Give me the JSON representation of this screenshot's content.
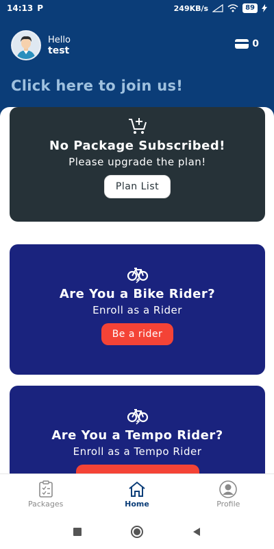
{
  "status_bar": {
    "time": "14:13",
    "carrier_icon": "P",
    "net_speed": "249KB/s",
    "battery": "89"
  },
  "header": {
    "hello": "Hello",
    "username": "test",
    "wallet_count": "0",
    "join_text": "Click here to join us!"
  },
  "cards": {
    "package": {
      "title": "No Package Subscribed!",
      "subtitle": "Please upgrade the plan!",
      "button": "Plan List"
    },
    "bike": {
      "title": "Are You a Bike Rider?",
      "subtitle": "Enroll as a Rider",
      "button": "Be a rider"
    },
    "tempo": {
      "title": "Are You a Tempo Rider?",
      "subtitle": "Enroll as a Tempo Rider",
      "button": ""
    }
  },
  "bottom_nav": {
    "items": [
      {
        "label": "Packages",
        "icon": "clipboard-icon"
      },
      {
        "label": "Home",
        "icon": "home-icon",
        "active": true
      },
      {
        "label": "Profile",
        "icon": "user-icon"
      }
    ]
  },
  "colors": {
    "header": "#0b3d78",
    "package_card": "#263238",
    "rider_card": "#1a237e",
    "accent_red": "#f44336"
  }
}
